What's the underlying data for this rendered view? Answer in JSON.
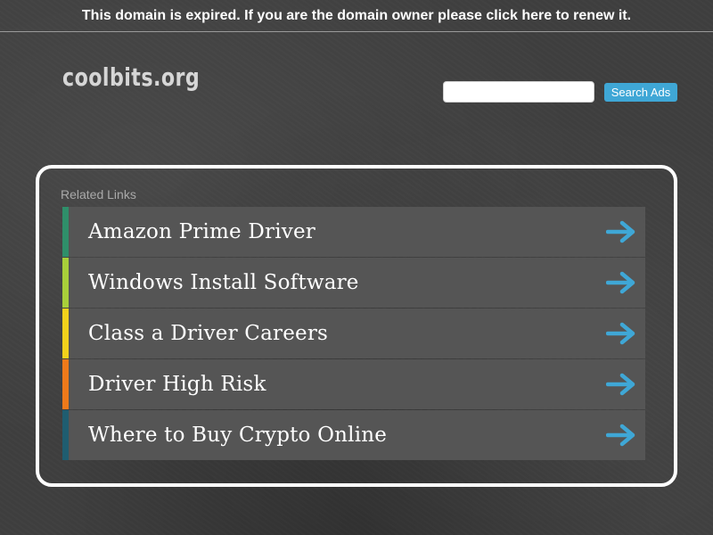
{
  "banner": {
    "text": "This domain is expired. If you are the domain owner please click here to renew it."
  },
  "header": {
    "logo_text": "coolbits.org"
  },
  "search": {
    "input_value": "",
    "button_label": "Search Ads"
  },
  "related_links": {
    "title": "Related Links",
    "items": [
      {
        "label": "Amazon Prime Driver",
        "stripe_color": "#2f8f6a",
        "arrow_icon": "arrow-right-icon"
      },
      {
        "label": "Windows Install Software",
        "stripe_color": "#a8cf3a",
        "arrow_icon": "arrow-right-icon"
      },
      {
        "label": "Class a Driver Careers",
        "stripe_color": "#f2d21b",
        "arrow_icon": "arrow-right-icon"
      },
      {
        "label": "Driver High Risk",
        "stripe_color": "#ee7a1a",
        "arrow_icon": "arrow-right-icon"
      },
      {
        "label": "Where to Buy Crypto Online",
        "stripe_color": "#1f5d70",
        "arrow_icon": "arrow-right-icon"
      }
    ]
  },
  "colors": {
    "accent": "#3fa7d6",
    "arrow": "#3fa7d6",
    "row_background": "#555555",
    "page_background": "#3f3f3f"
  }
}
